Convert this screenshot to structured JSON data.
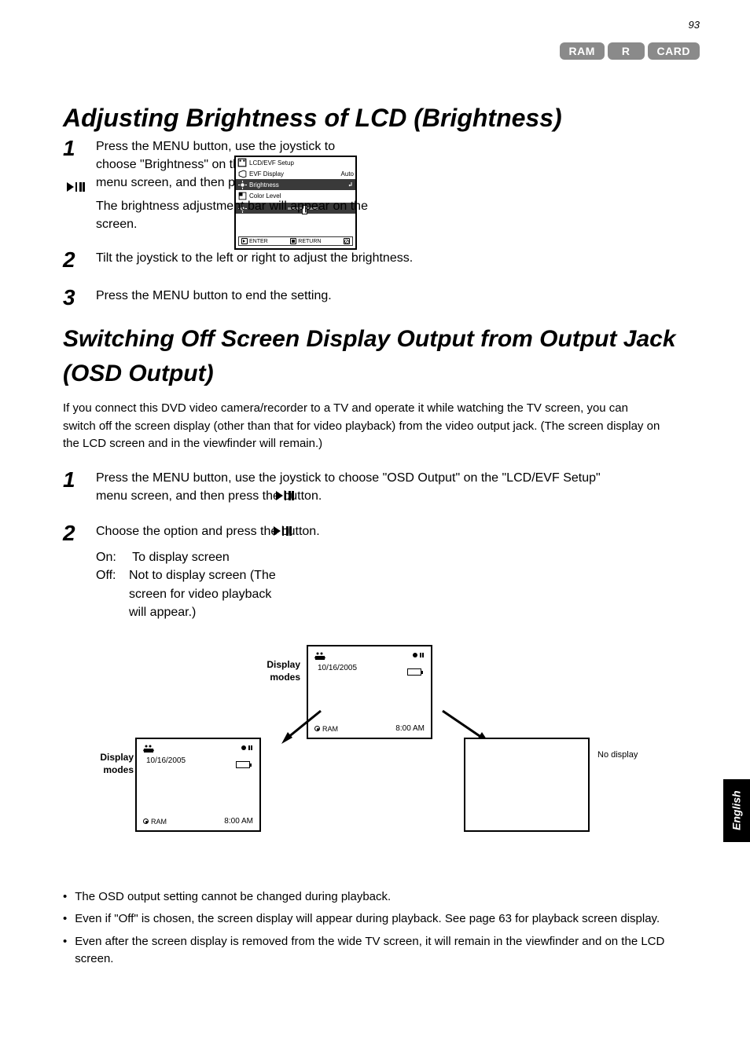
{
  "page_number": "93",
  "badges": {
    "ram": "RAM",
    "r": "R",
    "card": "CARD"
  },
  "title": "Adjusting Brightness of LCD (Brightness)",
  "subtitle": "",
  "steps": {
    "s1": {
      "line1": "Press the MENU button, use the joystick to",
      "line2": "choose \"Brightness\" on the \"LCD/EVF Setup\"",
      "line3": "menu screen, and then press the       button."
    },
    "s2": {
      "line1": "The brightness adjustment bar will appear on the screen.",
      "line2": "Tilt the joystick to the left or right to adjust the brightness."
    },
    "s3": {
      "line1": "Press the MENU button to end the setting."
    }
  },
  "menu": {
    "header": "LCD/EVF Setup",
    "items": [
      {
        "label": "EVF Display",
        "value": "Auto"
      },
      {
        "label": "Brightness",
        "value": ""
      },
      {
        "label": "Color Level",
        "value": ""
      }
    ],
    "footer": {
      "enter": "ENTER",
      "return": "RETURN"
    }
  },
  "osd_header": "Switching Off Screen Display Output from Output Jack (OSD Output)",
  "osd_intro": "If you connect this DVD video camera/recorder to a TV and operate it while watching the TV screen, you can switch off the screen display (other than that for video playback) from the video output jack. (The screen display on the LCD screen and in the viewfinder will remain.)",
  "osd_steps": {
    "s1": {
      "line1": "Press the MENU button, use the joystick to choose \"OSD Output\" on the \"LCD/EVF Setup\"",
      "line2": "menu screen, and then press the       button."
    },
    "s2": {
      "line1": "Choose the option and press the       button."
    }
  },
  "options": {
    "on_label": "On:",
    "on_text": "To display screen",
    "off_label": "Off:",
    "off_text": "Not to display screen (The screen for video playback will appear.)"
  },
  "display_modes": "Display modes",
  "box_a": {
    "label": "10/16/2005",
    "time": "8:00 AM"
  },
  "box_b": {
    "label": "10/16/2005",
    "time": "8:00 AM"
  },
  "no_display": "No display",
  "ram_label": "RAM",
  "bullets": {
    "b1": "The OSD output setting cannot be changed during playback.",
    "b2": "Even if \"Off\" is chosen, the screen display will appear during playback. See page 63 for playback screen display.",
    "b3": "Even after the screen display is removed from the wide TV screen, it will remain in the viewfinder and on the LCD screen."
  },
  "side_tab": "English"
}
